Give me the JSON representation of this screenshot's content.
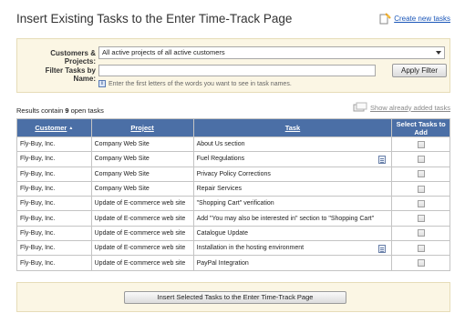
{
  "page": {
    "title": "Insert Existing Tasks to the Enter Time-Track Page",
    "create_link_label": "Create new tasks"
  },
  "filter": {
    "customers_label": "Customers & Projects:",
    "customers_value": "All active projects of all active customers",
    "name_label": "Filter Tasks by Name:",
    "name_value": "",
    "apply_label": "Apply Filter",
    "hint": "Enter the first letters of the words you want to see in task names.",
    "info_glyph": "i"
  },
  "results": {
    "prefix": "Results contain ",
    "count": "9",
    "suffix": " open tasks",
    "show_added_label": "Show already added tasks"
  },
  "table": {
    "headers": {
      "customer": "Customer",
      "sort_glyph": "▲",
      "project": "Project",
      "task": "Task",
      "select": "Select Tasks to Add"
    },
    "rows": [
      {
        "customer": "Fly-Buy, Inc.",
        "project": "Company Web Site",
        "task": "About Us section",
        "has_note": false,
        "checked": false
      },
      {
        "customer": "Fly-Buy, Inc.",
        "project": "Company Web Site",
        "task": "Fuel Regulations",
        "has_note": true,
        "checked": false
      },
      {
        "customer": "Fly-Buy, Inc.",
        "project": "Company Web Site",
        "task": "Privacy Policy Corrections",
        "has_note": false,
        "checked": false
      },
      {
        "customer": "Fly-Buy, Inc.",
        "project": "Company Web Site",
        "task": "Repair Services",
        "has_note": false,
        "checked": false
      },
      {
        "customer": "Fly-Buy, Inc.",
        "project": "Update of E-commerce web site",
        "task": "\"Shopping Cart\" verification",
        "has_note": false,
        "checked": false
      },
      {
        "customer": "Fly-Buy, Inc.",
        "project": "Update of E-commerce web site",
        "task": "Add \"You may also be interested in\" section to \"Shopping Cart\"",
        "has_note": false,
        "checked": false
      },
      {
        "customer": "Fly-Buy, Inc.",
        "project": "Update of E-commerce web site",
        "task": "Catalogue Update",
        "has_note": false,
        "checked": false
      },
      {
        "customer": "Fly-Buy, Inc.",
        "project": "Update of E-commerce web site",
        "task": "Installation in the hosting environment",
        "has_note": true,
        "checked": false
      },
      {
        "customer": "Fly-Buy, Inc.",
        "project": "Update of E-commerce web site",
        "task": "PayPal Integration",
        "has_note": false,
        "checked": false
      }
    ]
  },
  "footer": {
    "insert_label": "Insert Selected Tasks to the Enter Time-Track Page"
  },
  "colors": {
    "header_bg": "#4b6fa6",
    "panel_bg": "#fbf6e4",
    "link": "#1a56b8"
  },
  "icons": {
    "create": "create-task-icon",
    "show_added": "show-tasks-icon",
    "note": "task-note-icon",
    "info": "info-icon"
  }
}
